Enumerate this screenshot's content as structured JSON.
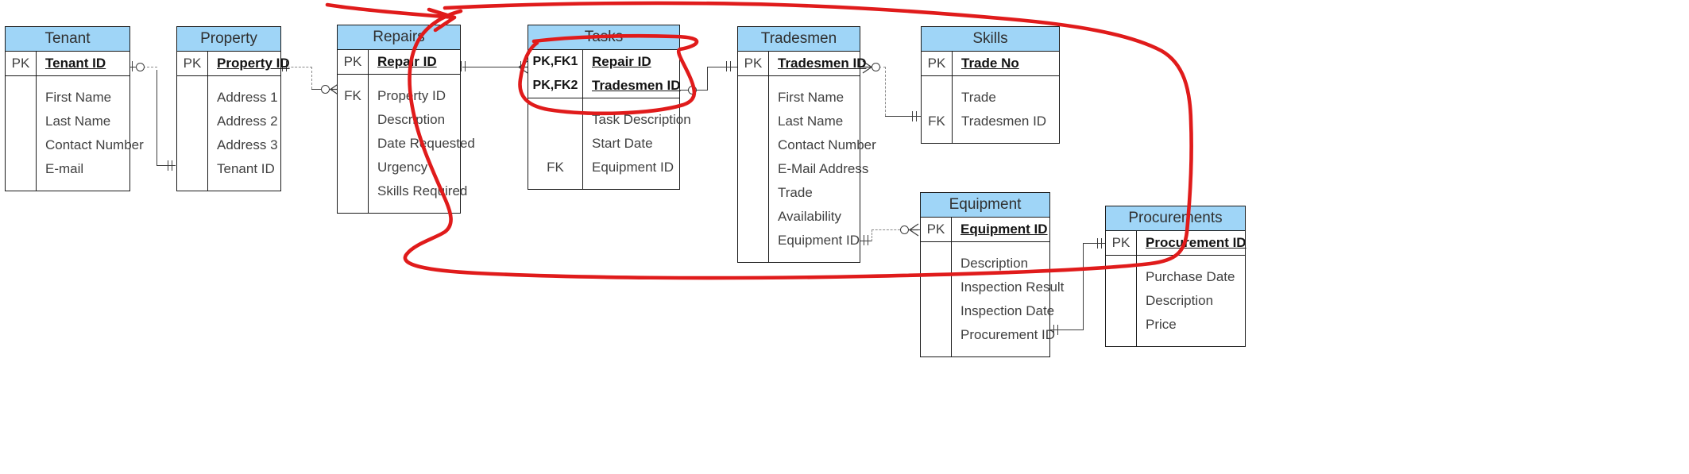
{
  "diagram": {
    "type": "entity-relationship-diagram",
    "notation": "crows-foot",
    "title_fill": "#9fd5f7",
    "annotation_color": "#e01b1b",
    "annotation_note": "hand-drawn red loops circling the Repairs-Tasks-Tradesmen region and the Tasks composite key rows"
  },
  "entities": [
    {
      "id": "tenant",
      "name": "Tenant",
      "attributes": [
        {
          "key": "PK",
          "name": "Tenant ID",
          "is_key": true
        },
        {
          "key": "",
          "name": "First Name",
          "is_key": false
        },
        {
          "key": "",
          "name": "Last Name",
          "is_key": false
        },
        {
          "key": "",
          "name": "Contact Number",
          "is_key": false
        },
        {
          "key": "",
          "name": "E-mail",
          "is_key": false
        }
      ]
    },
    {
      "id": "property",
      "name": "Property",
      "attributes": [
        {
          "key": "PK",
          "name": "Property ID",
          "is_key": true
        },
        {
          "key": "",
          "name": "Address 1",
          "is_key": false
        },
        {
          "key": "",
          "name": "Address 2",
          "is_key": false
        },
        {
          "key": "",
          "name": "Address 3",
          "is_key": false
        },
        {
          "key": "",
          "name": "Tenant ID",
          "is_key": false
        }
      ]
    },
    {
      "id": "repairs",
      "name": "Repairs",
      "attributes": [
        {
          "key": "PK",
          "name": "Repair ID",
          "is_key": true
        },
        {
          "key": "FK",
          "name": "Property ID",
          "is_key": false
        },
        {
          "key": "",
          "name": "Description",
          "is_key": false
        },
        {
          "key": "",
          "name": "Date Requested",
          "is_key": false
        },
        {
          "key": "",
          "name": "Urgency",
          "is_key": false
        },
        {
          "key": "",
          "name": "Skills Required",
          "is_key": false
        }
      ]
    },
    {
      "id": "tasks",
      "name": "Tasks",
      "attributes": [
        {
          "key": "PK,FK1",
          "name": "Repair ID",
          "is_key": true
        },
        {
          "key": "PK,FK2",
          "name": "Tradesmen ID",
          "is_key": true
        },
        {
          "key": "",
          "name": "Task Description",
          "is_key": false
        },
        {
          "key": "",
          "name": "Start Date",
          "is_key": false
        },
        {
          "key": "FK",
          "name": "Equipment ID",
          "is_key": false
        }
      ]
    },
    {
      "id": "tradesmen",
      "name": "Tradesmen",
      "attributes": [
        {
          "key": "PK",
          "name": "Tradesmen ID",
          "is_key": true
        },
        {
          "key": "",
          "name": "First Name",
          "is_key": false
        },
        {
          "key": "",
          "name": "Last Name",
          "is_key": false
        },
        {
          "key": "",
          "name": "Contact Number",
          "is_key": false
        },
        {
          "key": "",
          "name": "E-Mail Address",
          "is_key": false
        },
        {
          "key": "",
          "name": "Trade",
          "is_key": false
        },
        {
          "key": "",
          "name": "Availability",
          "is_key": false
        },
        {
          "key": "",
          "name": "Equipment ID",
          "is_key": false
        }
      ]
    },
    {
      "id": "skills",
      "name": "Skills",
      "attributes": [
        {
          "key": "PK",
          "name": "Trade No",
          "is_key": true
        },
        {
          "key": "",
          "name": "Trade",
          "is_key": false
        },
        {
          "key": "FK",
          "name": "Tradesmen ID",
          "is_key": false
        }
      ]
    },
    {
      "id": "equipment",
      "name": "Equipment",
      "attributes": [
        {
          "key": "PK",
          "name": "Equipment ID",
          "is_key": true
        },
        {
          "key": "",
          "name": "Description",
          "is_key": false
        },
        {
          "key": "",
          "name": "Inspection Result",
          "is_key": false
        },
        {
          "key": "",
          "name": "Inspection Date",
          "is_key": false
        },
        {
          "key": "",
          "name": "Procurement ID",
          "is_key": false
        }
      ]
    },
    {
      "id": "procurements",
      "name": "Procurements",
      "attributes": [
        {
          "key": "PK",
          "name": "Procurement ID",
          "is_key": true
        },
        {
          "key": "",
          "name": "Purchase Date",
          "is_key": false
        },
        {
          "key": "",
          "name": "Description",
          "is_key": false
        },
        {
          "key": "",
          "name": "Price",
          "is_key": false
        }
      ]
    }
  ]
}
